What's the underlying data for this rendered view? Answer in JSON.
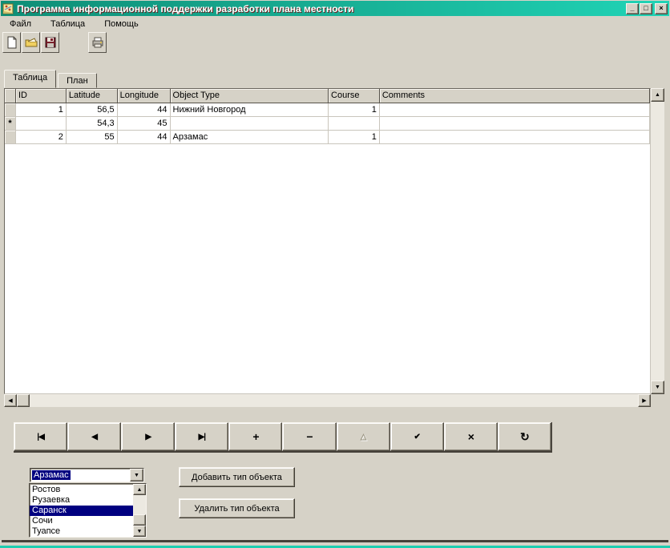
{
  "window": {
    "title": "Программа информационной поддержки разработки плана местности",
    "controls": {
      "minimize": "_",
      "maximize": "□",
      "close": "×"
    }
  },
  "menu": {
    "items": [
      "Файл",
      "Таблица",
      "Помощь"
    ]
  },
  "toolbar": {
    "icons": [
      "new-file-icon",
      "open-folder-icon",
      "save-icon",
      "print-icon"
    ]
  },
  "tabs": {
    "active": "Таблица",
    "inactive": "План"
  },
  "grid": {
    "columns": [
      "ID",
      "Latitude",
      "Longitude",
      "Object Type",
      "Course",
      "Comments"
    ],
    "indicators": [
      "",
      "*",
      ""
    ],
    "rows": [
      [
        "1",
        "56,5",
        "44",
        "Нижний Новгород",
        "1",
        ""
      ],
      [
        "",
        "54,3",
        "45",
        "",
        "",
        ""
      ],
      [
        "2",
        "55",
        "44",
        "Арзамас",
        "1",
        ""
      ]
    ]
  },
  "navigator": {
    "buttons": [
      {
        "name": "first-record",
        "glyph": "|◀",
        "enabled": true,
        "big": false
      },
      {
        "name": "prior-record",
        "glyph": "◀",
        "enabled": true,
        "big": false
      },
      {
        "name": "next-record",
        "glyph": "▶",
        "enabled": true,
        "big": false
      },
      {
        "name": "last-record",
        "glyph": "▶|",
        "enabled": true,
        "big": false
      },
      {
        "name": "insert-record",
        "glyph": "+",
        "enabled": true,
        "big": true
      },
      {
        "name": "delete-record",
        "glyph": "−",
        "enabled": true,
        "big": true
      },
      {
        "name": "edit-record",
        "glyph": "△",
        "enabled": false,
        "big": false
      },
      {
        "name": "post-edit",
        "glyph": "✔",
        "enabled": true,
        "big": false
      },
      {
        "name": "cancel-edit",
        "glyph": "×",
        "enabled": true,
        "big": true
      },
      {
        "name": "refresh-data",
        "glyph": "↻",
        "enabled": true,
        "big": true
      }
    ]
  },
  "combo": {
    "value": "Арзамас",
    "arrow": "▼"
  },
  "type_list": {
    "items": [
      "Ростов",
      "Рузаевка",
      "Саранск",
      "Сочи",
      "Туапсе"
    ],
    "selected_index": 2
  },
  "actions": {
    "add": "Добавить тип объекта",
    "remove": "Удалить тип объекта"
  },
  "scroll_arrows": {
    "up": "▲",
    "down": "▼",
    "left": "◀",
    "right": "▶"
  },
  "colors": {
    "titlebar_gradient_start": "#0e8e76",
    "titlebar_gradient_end": "#20d4b6",
    "selection": "#000080",
    "face": "#d6d2c7",
    "teal_strip": "#1ecdb0"
  }
}
